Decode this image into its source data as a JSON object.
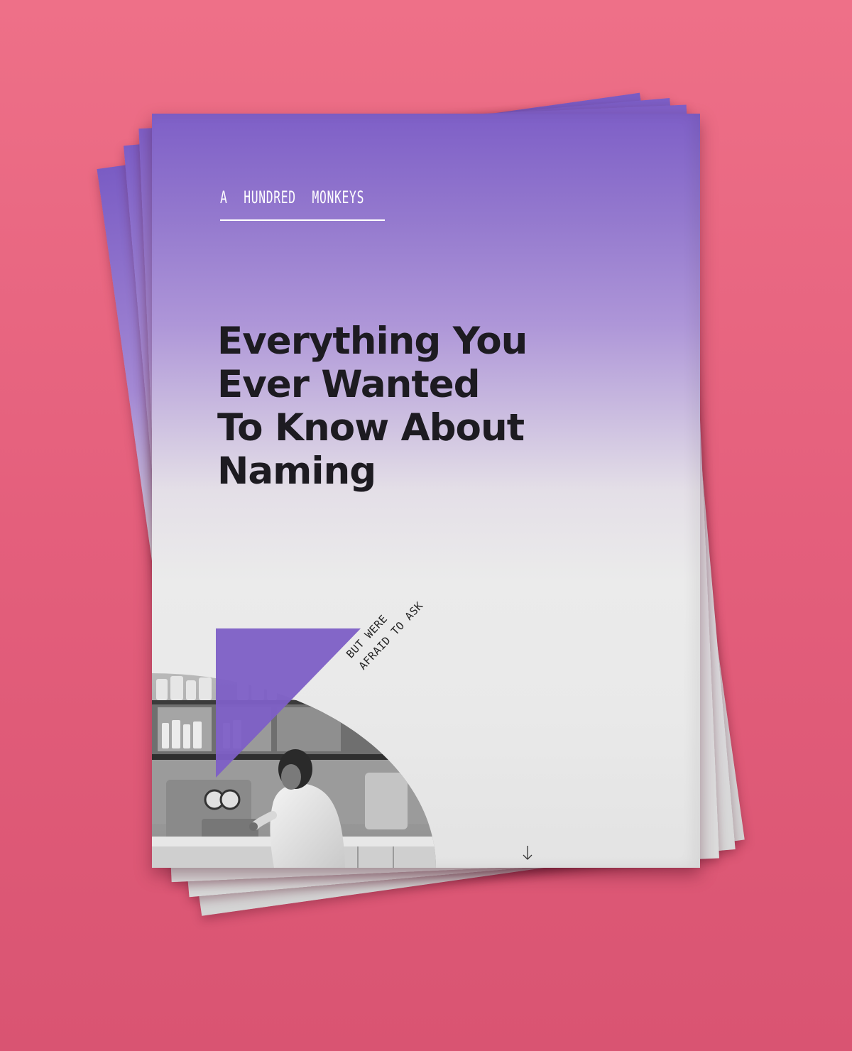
{
  "brochure": {
    "brand": "A HUNDRED MONKEYS",
    "headline_lines": [
      "Everything You",
      "Ever Wanted",
      "To Know About",
      "Naming"
    ],
    "tagline_lines": [
      "BUT WERE",
      "AFRAID TO ASK"
    ],
    "photo": "black-and-white photo of a scientist in a lab coat working at laboratory equipment",
    "scroll_icon": "down-arrow-icon"
  },
  "colors": {
    "background": "#e8667f",
    "accent_purple": "#7d5fc6",
    "headline_text": "#1d1b21",
    "brand_text": "#ffffff"
  }
}
